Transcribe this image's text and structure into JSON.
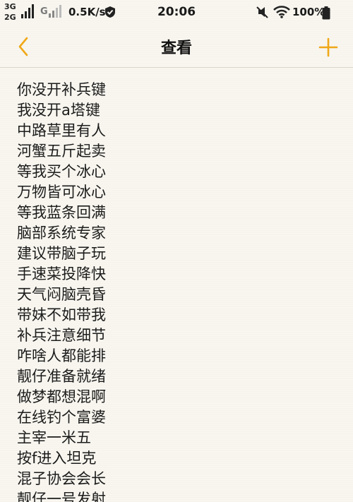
{
  "status_bar": {
    "network_top": "3G",
    "network_bottom": "2G",
    "network_g": "G",
    "speed": "0.5K/s",
    "time": "20:06",
    "battery": "100%"
  },
  "nav": {
    "title": "查看"
  },
  "colors": {
    "accent": "#f0a818",
    "background": "#f8f6ef",
    "text": "#1c1c1c"
  },
  "icons": {
    "back": "chevron-left-icon",
    "add": "plus-icon"
  },
  "note": {
    "lines": [
      "你没开补兵键",
      "我没开a塔键",
      "中路草里有人",
      "河蟹五斤起卖",
      "等我买个冰心",
      "万物皆可冰心",
      "等我蓝条回满",
      "脑部系统专家",
      "建议带脑子玩",
      "手速菜投降快",
      "天气闷脑壳昏",
      "带妹不如带我",
      "补兵注意细节",
      "咋啥人都能排",
      "靓仔准备就绪",
      "做梦都想混啊",
      "在线钓个富婆",
      "主宰一米五",
      "按f进入坦克",
      "混子协会会长",
      "靓仔一号发射"
    ]
  }
}
